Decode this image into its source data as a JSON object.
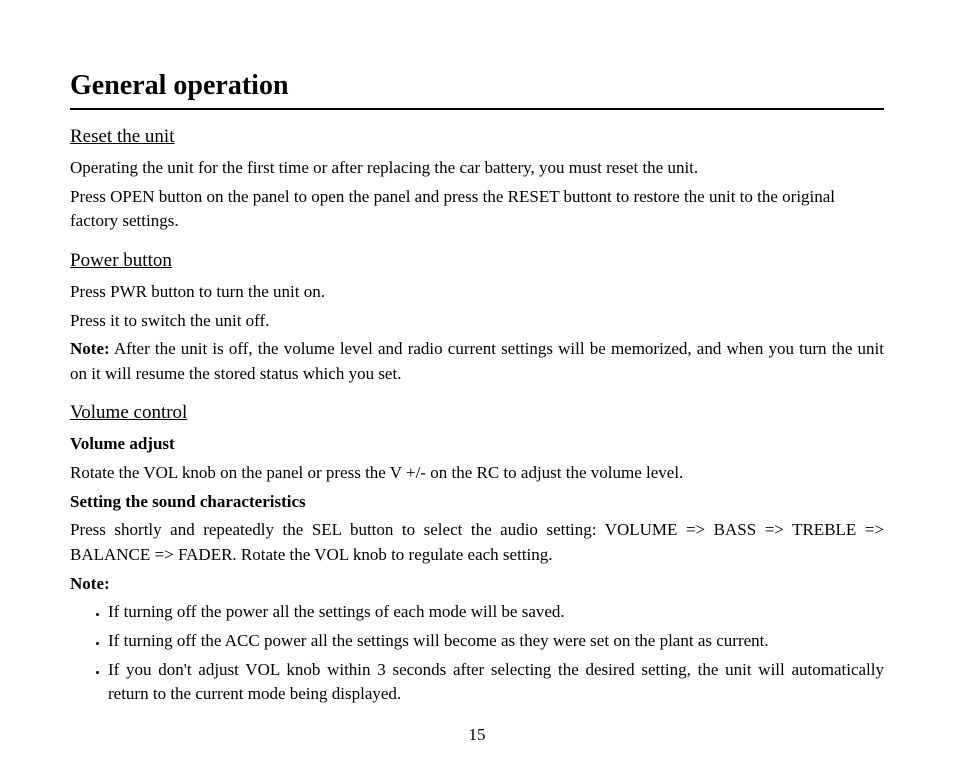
{
  "title": "General operation",
  "sections": {
    "reset": {
      "heading": "Reset the unit",
      "p1": "Operating the unit for the first time or after replacing the car battery, you must reset the unit.",
      "p2": "Press OPEN button on the panel to open the panel and press the RESET buttont to restore the unit to the original factory settings."
    },
    "power": {
      "heading": "Power button",
      "p1": "Press PWR button to turn the unit on.",
      "p2": "Press it to switch the unit off.",
      "note_label": "Note:",
      "note_text": " After the unit is off, the volume level and radio current settings will be memorized, and when you turn the unit on it will resume the stored status which you set."
    },
    "volume": {
      "heading": "Volume control",
      "sub1": "Volume adjust",
      "p1": "Rotate the VOL knob on the panel or press the V +/- on the RC to adjust the volume level.",
      "sub2": "Setting the sound characteristics",
      "p2": "Press shortly and repeatedly the SEL button to select the audio setting: VOLUME => BASS => TREBLE => BALANCE => FADER. Rotate the VOL knob to regulate each setting.",
      "note_label": "Note:",
      "bullets": [
        "If turning off the power all the settings of each mode will be saved.",
        "If turning off the ACC power all the settings will become as they were set on the plant as current.",
        "If you don't adjust VOL knob within 3 seconds after selecting the desired setting, the unit will automatically return to the current mode being displayed."
      ]
    }
  },
  "page_number": "15"
}
